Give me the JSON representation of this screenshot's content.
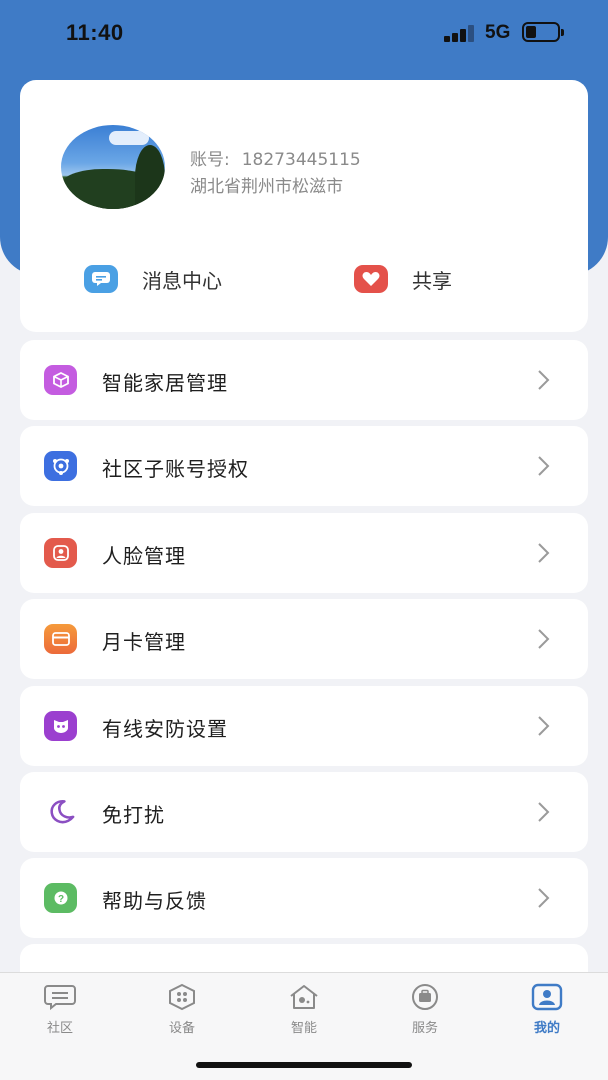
{
  "status_bar": {
    "time": "11:40",
    "network": "5G"
  },
  "profile": {
    "account_label": "账号:",
    "account_number": "18273445115",
    "address": "湖北省荆州市松滋市"
  },
  "quick_actions": [
    {
      "label": "消息中心",
      "icon": "message-icon",
      "color": "#4aa0e4"
    },
    {
      "label": "共享",
      "icon": "heart-icon",
      "color": "#e4514a"
    }
  ],
  "menu": [
    {
      "label": "智能家居管理",
      "icon": "smart-home-icon",
      "color": "#c45ce0"
    },
    {
      "label": "社区子账号授权",
      "icon": "sub-account-icon",
      "color": "#3d6fe0"
    },
    {
      "label": "人脸管理",
      "icon": "face-icon",
      "color": "#e35a4c"
    },
    {
      "label": "月卡管理",
      "icon": "card-icon",
      "color": "#f0803a"
    },
    {
      "label": "有线安防设置",
      "icon": "security-icon",
      "color": "#9b3fcf"
    },
    {
      "label": "免打扰",
      "icon": "moon-icon",
      "color": "#8b4fc2"
    },
    {
      "label": "帮助与反馈",
      "icon": "help-icon",
      "color": "#5cbb63"
    }
  ],
  "tabs": [
    {
      "label": "社区",
      "icon": "community-icon",
      "active": false
    },
    {
      "label": "设备",
      "icon": "device-icon",
      "active": false
    },
    {
      "label": "智能",
      "icon": "smart-icon",
      "active": false
    },
    {
      "label": "服务",
      "icon": "service-icon",
      "active": false
    },
    {
      "label": "我的",
      "icon": "profile-icon",
      "active": true
    }
  ],
  "accent_color": "#3f7bc6"
}
